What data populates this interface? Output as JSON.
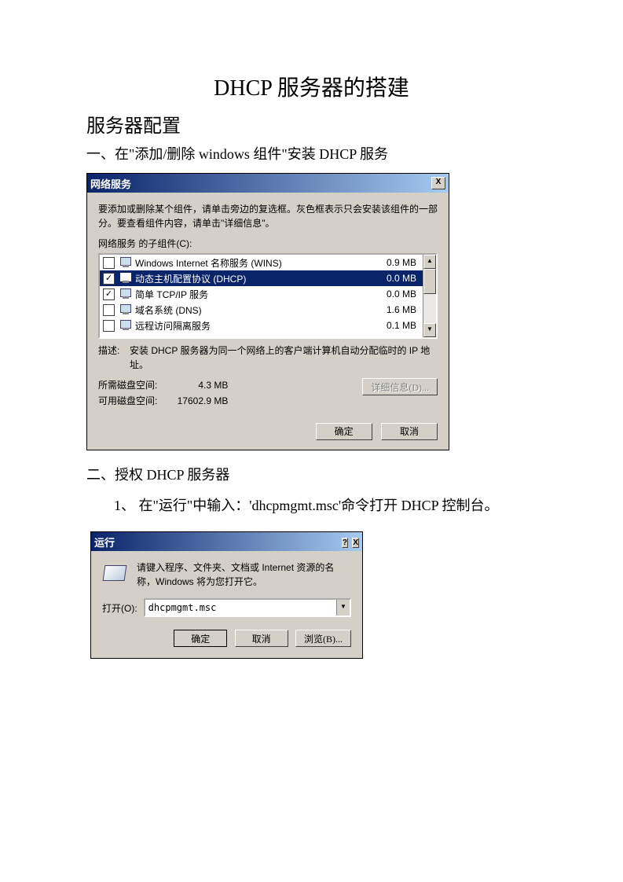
{
  "doc": {
    "title": "DHCP 服务器的搭建",
    "h_server_config": "服务器配置",
    "step1": "一、在\"添加/删除 windows 组件\"安装 DHCP 服务",
    "step2": "二、授权 DHCP 服务器",
    "step2_sub1": "1、 在\"运行\"中输入：'dhcpmgmt.msc'命令打开 DHCP 控制台。"
  },
  "net_dialog": {
    "title": "网络服务",
    "close_x": "X",
    "instruction": "要添加或删除某个组件，请单击旁边的复选框。灰色框表示只会安装该组件的一部分。要查看组件内容，请单击\"详细信息\"。",
    "sub_label": "网络服务 的子组件(C):",
    "items": [
      {
        "checked": false,
        "label": "Windows Internet 名称服务 (WINS)",
        "size": "0.9 MB",
        "selected": false
      },
      {
        "checked": true,
        "label": "动态主机配置协议 (DHCP)",
        "size": "0.0 MB",
        "selected": true
      },
      {
        "checked": true,
        "label": "简单 TCP/IP 服务",
        "size": "0.0 MB",
        "selected": false
      },
      {
        "checked": false,
        "label": "域名系统 (DNS)",
        "size": "1.6 MB",
        "selected": false
      },
      {
        "checked": false,
        "label": "远程访问隔离服务",
        "size": "0.1 MB",
        "selected": false
      }
    ],
    "desc_label": "描述:",
    "desc_text": "安装 DHCP 服务器为同一个网络上的客户端计算机自动分配临时的 IP 地址。",
    "required_label": "所需磁盘空间:",
    "required_value": "4.3 MB",
    "available_label": "可用磁盘空间:",
    "available_value": "17602.9 MB",
    "details_btn": "详细信息(D)...",
    "ok_btn": "确定",
    "cancel_btn": "取消"
  },
  "run_dialog": {
    "title": "运行",
    "help_q": "?",
    "close_x": "X",
    "prompt": "请键入程序、文件夹、文档或 Internet 资源的名称，Windows 将为您打开它。",
    "open_label": "打开(O):",
    "input_value": "dhcpmgmt.msc",
    "ok_btn": "确定",
    "cancel_btn": "取消",
    "browse_btn": "浏览(B)..."
  }
}
